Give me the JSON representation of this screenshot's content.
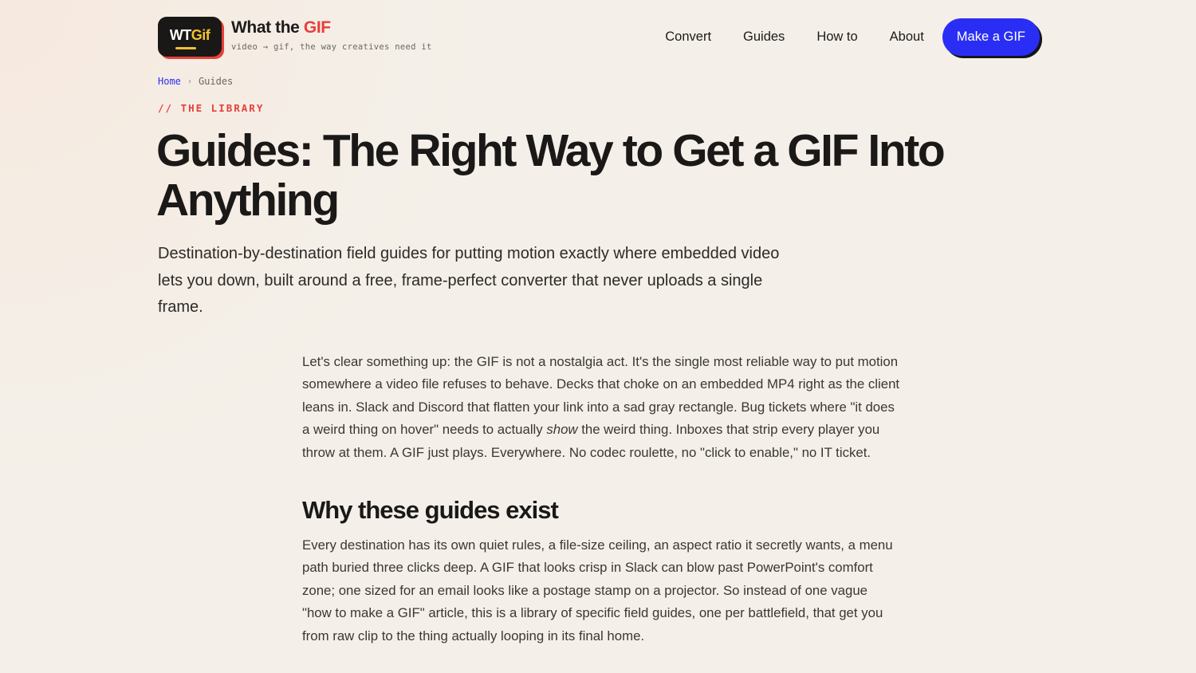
{
  "header": {
    "logo": {
      "wt": "WT",
      "gif": "Gif"
    },
    "brand_title_main": "What the ",
    "brand_title_accent": "GIF",
    "tagline": "video → gif, the way creatives need it",
    "nav": [
      "Convert",
      "Guides",
      "How to",
      "About"
    ],
    "cta_label": "Make a GIF"
  },
  "breadcrumb": {
    "home": "Home",
    "separator": "›",
    "current": "Guides"
  },
  "eyebrow": "// THE LIBRARY",
  "title": "Guides: The Right Way to Get a GIF Into Anything",
  "lede": "Destination-by-destination field guides for putting motion exactly where embedded video lets you down, built around a free, frame-perfect converter that never uploads a single frame.",
  "article": {
    "p1_before": "Let's clear something up: the GIF is not a nostalgia act. It's the single most reliable way to put motion somewhere a video file refuses to behave. Decks that choke on an embedded MP4 right as the client leans in. Slack and Discord that flatten your link into a sad gray rectangle. Bug tickets where \"it does a weird thing on hover\" needs to actually ",
    "p1_em": "show",
    "p1_after": " the weird thing. Inboxes that strip every player you throw at them. A GIF just plays. Everywhere. No codec roulette, no \"click to enable,\" no IT ticket.",
    "h2": "Why these guides exist",
    "p2": "Every destination has its own quiet rules, a file-size ceiling, an aspect ratio it secretly wants, a menu path buried three clicks deep. A GIF that looks crisp in Slack can blow past PowerPoint's comfort zone; one sized for an email looks like a postage stamp on a projector. So instead of one vague \"how to make a GIF\" article, this is a library of specific field guides, one per battlefield, that get you from raw clip to the thing actually looping in its final home."
  },
  "colors": {
    "accent_red": "#e6403a",
    "accent_blue": "#2a2ef5",
    "logo_yellow": "#f3c132",
    "background": "#f4f0e9"
  }
}
